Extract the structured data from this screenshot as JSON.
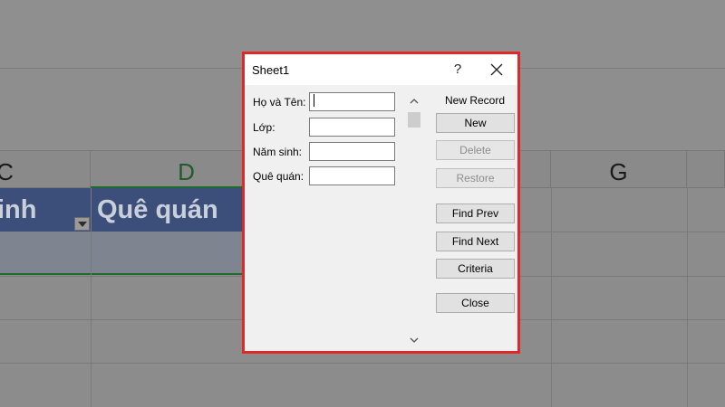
{
  "spreadsheet": {
    "columns": [
      {
        "letter": "C"
      },
      {
        "letter": "D"
      },
      {
        "letter": "G"
      }
    ],
    "header_cells": {
      "nam_sinh_fragment": "inh",
      "que_quan": "Quê quán"
    }
  },
  "dialog": {
    "title": "Sheet1",
    "help_label": "?",
    "fields": [
      {
        "label": "Họ và Tên:",
        "value": ""
      },
      {
        "label": "Lớp:",
        "value": ""
      },
      {
        "label": "Năm sinh:",
        "value": ""
      },
      {
        "label": "Quê quán:",
        "value": ""
      }
    ],
    "record_status": "New Record",
    "buttons": {
      "new": "New",
      "delete": "Delete",
      "restore": "Restore",
      "find_prev": "Find Prev",
      "find_next": "Find Next",
      "criteria": "Criteria",
      "close": "Close"
    },
    "colors": {
      "border": "#e02828",
      "background": "#f0f0f0",
      "disabled_text": "#8d8d8d"
    }
  }
}
